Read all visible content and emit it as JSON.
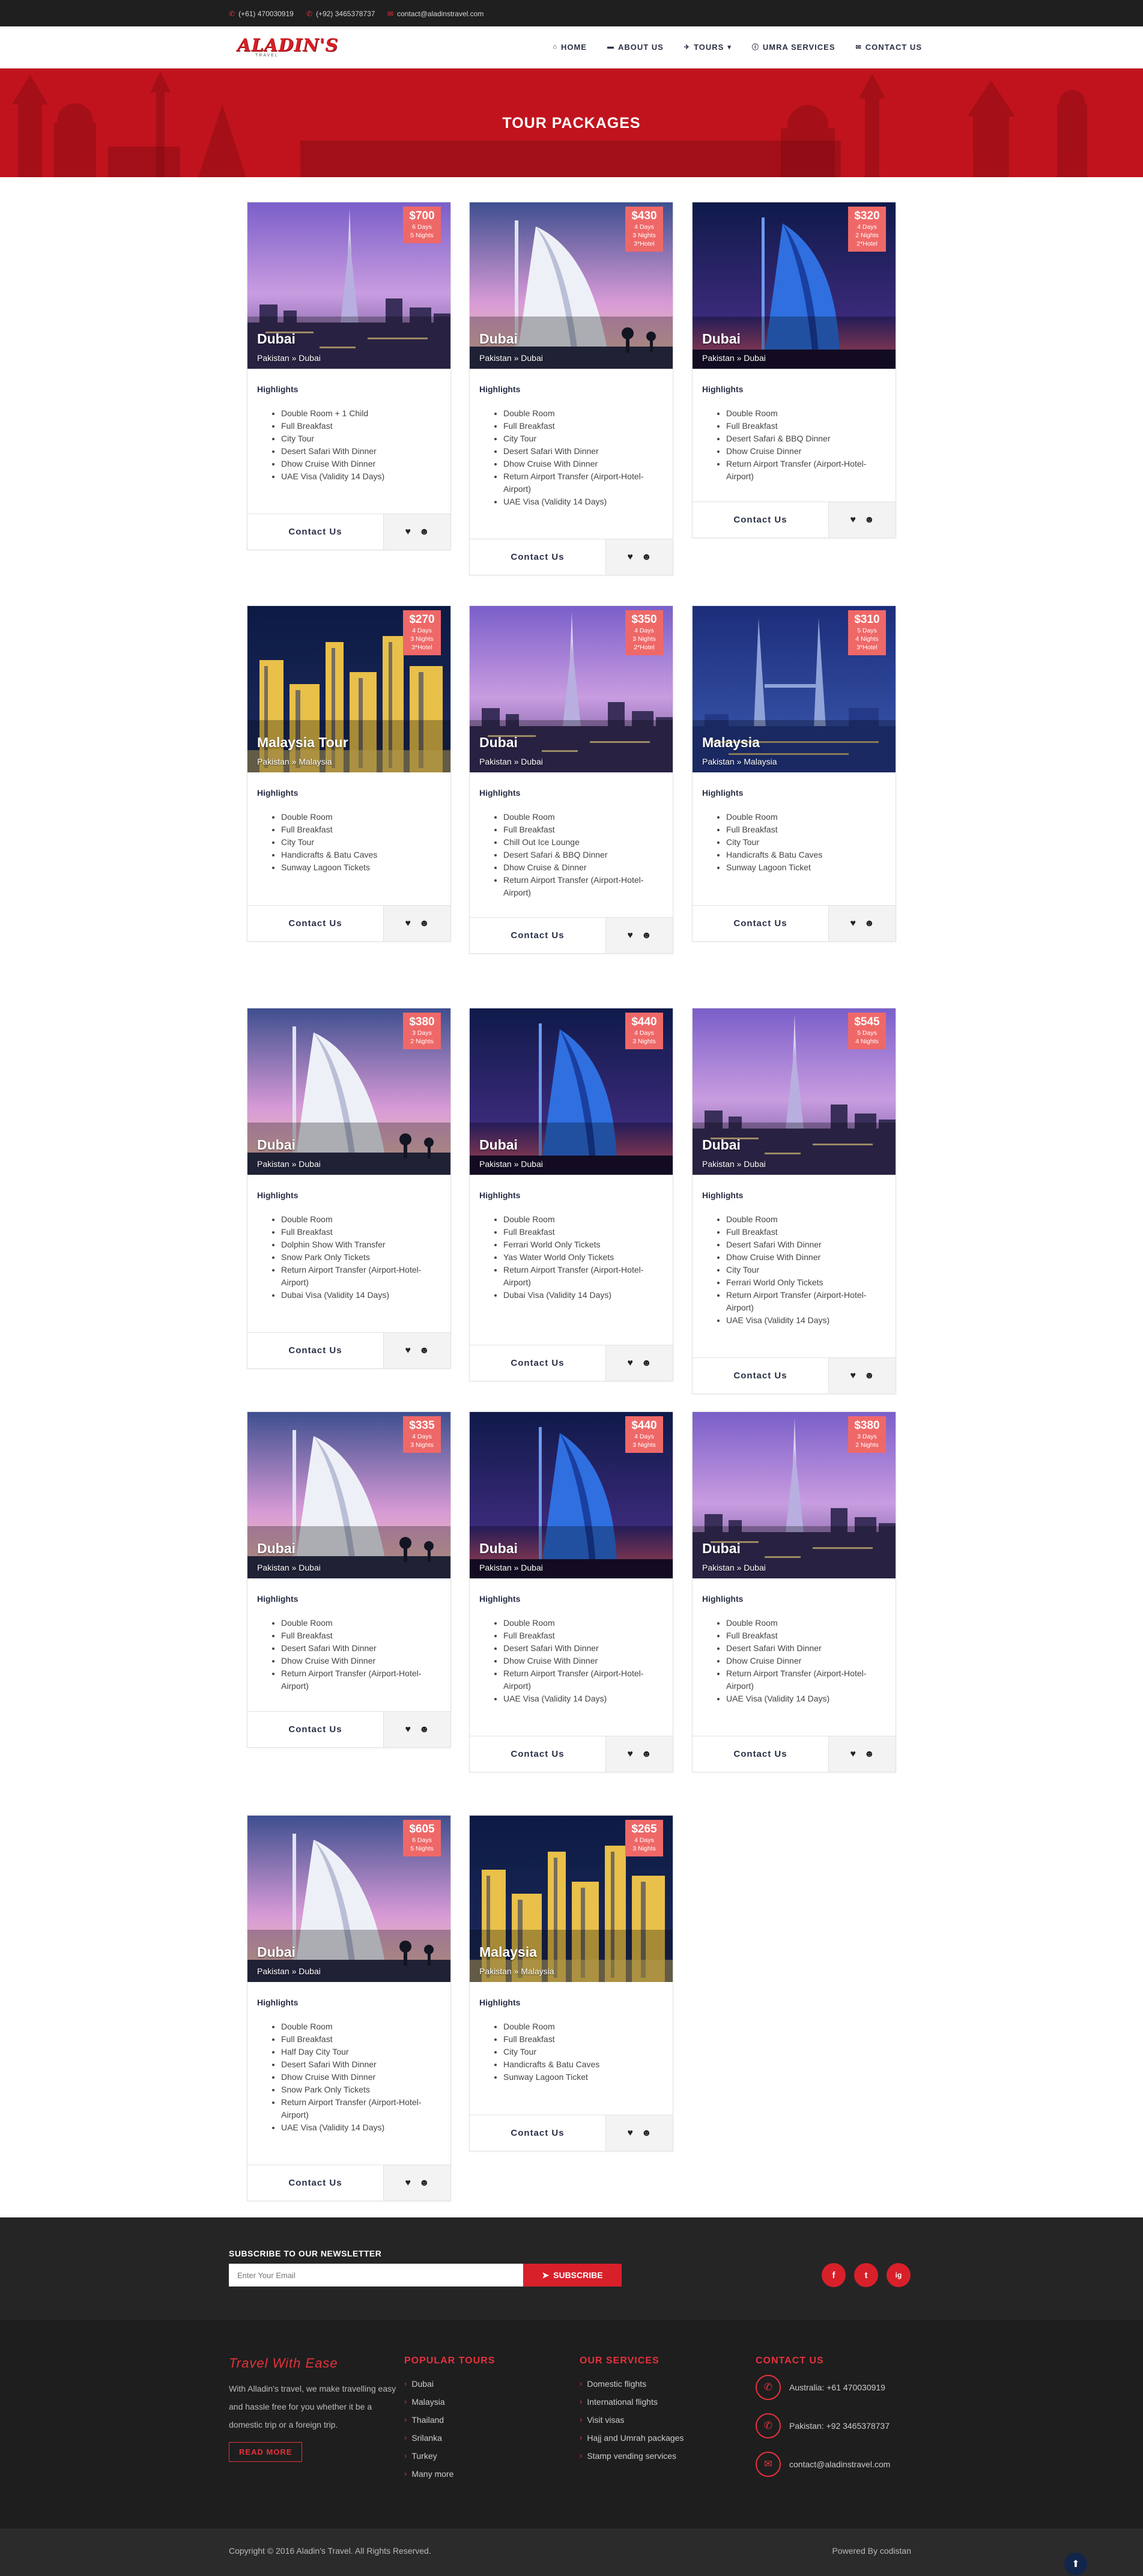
{
  "topbar": {
    "phone1": "(+61) 470030919",
    "phone2": "(+92) 3465378737",
    "email": "contact@aladinstravel.com"
  },
  "brand": {
    "logo_text": "ALADIN'S",
    "logo_sub": "TRAVEL",
    "accent": "#d8202a"
  },
  "menu": {
    "home": "HOME",
    "about": "ABOUT US",
    "tours": "TOURS",
    "umra": "UMRA SERVICES",
    "contact": "CONTACT US"
  },
  "hero": {
    "title": "TOUR PACKAGES"
  },
  "common": {
    "highlights": "Highlights",
    "contact_btn": "Contact Us"
  },
  "cards": [
    {
      "price": "$700",
      "dur": [
        "6 Days",
        "5 Nights"
      ],
      "title": "Dubai",
      "route": "Pakistan » Dubai",
      "scene": "burj_khalifa",
      "items": [
        "Double Room + 1 Child",
        "Full Breakfast",
        "City Tour",
        "Desert Safari With Dinner",
        "Dhow Cruise With Dinner",
        "UAE Visa (Validity 14 Days)"
      ]
    },
    {
      "price": "$430",
      "dur": [
        "4 Days",
        "3 Nights",
        "3*Hotel"
      ],
      "title": "Dubai",
      "route": "Pakistan » Dubai",
      "scene": "burj_arab_day",
      "items": [
        "Double Room",
        "Full Breakfast",
        "City Tour",
        "Desert Safari With Dinner",
        "Dhow Cruise With Dinner",
        "Return Airport Transfer (Airport-Hotel-Airport)",
        "UAE Visa (Validity 14 Days)"
      ]
    },
    {
      "price": "$320",
      "dur": [
        "4 Days",
        "2 Nights",
        "2*Hotel"
      ],
      "title": "Dubai",
      "route": "Pakistan » Dubai",
      "scene": "burj_arab_night",
      "items": [
        "Double Room",
        "Full Breakfast",
        "Desert Safari & BBQ Dinner",
        "Dhow Cruise Dinner",
        "Return Airport Transfer (Airport-Hotel-Airport)"
      ]
    },
    {
      "price": "$270",
      "dur": [
        "4 Days",
        "3 Nights",
        "3*Hotel"
      ],
      "title": "Malaysia Tour",
      "route": "Pakistan » Malaysia",
      "scene": "kl_night",
      "items": [
        "Double Room",
        "Full Breakfast",
        "City Tour",
        "Handicrafts & Batu Caves",
        "Sunway Lagoon Tickets"
      ]
    },
    {
      "price": "$350",
      "dur": [
        "4 Days",
        "3 Nights",
        "2*Hotel"
      ],
      "title": "Dubai",
      "route": "Pakistan » Dubai",
      "scene": "burj_khalifa",
      "items": [
        "Double Room",
        "Full Breakfast",
        "Chill Out Ice Lounge",
        "Desert Safari & BBQ Dinner",
        "Dhow Cruise & Dinner",
        "Return Airport Transfer (Airport-Hotel-Airport)"
      ]
    },
    {
      "price": "$310",
      "dur": [
        "5 Days",
        "4 Nights",
        "3*Hotel"
      ],
      "title": "Malaysia",
      "route": "Pakistan » Malaysia",
      "scene": "petronas",
      "items": [
        "Double Room",
        "Full Breakfast",
        "City Tour",
        "Handicrafts & Batu Caves",
        "Sunway Lagoon Ticket"
      ]
    },
    {
      "price": "$380",
      "dur": [
        "3 Days",
        "2 Nights"
      ],
      "title": "Dubai",
      "route": "Pakistan » Dubai",
      "scene": "burj_arab_day",
      "items": [
        "Double Room",
        "Full Breakfast",
        "Dolphin Show With Transfer",
        "Snow Park Only Tickets",
        "Return Airport Transfer (Airport-Hotel-Airport)",
        "Dubai Visa (Validity 14 Days)"
      ]
    },
    {
      "price": "$440",
      "dur": [
        "4 Days",
        "3 Nights"
      ],
      "title": "Dubai",
      "route": "Pakistan » Dubai",
      "scene": "burj_arab_night",
      "items": [
        "Double Room",
        "Full Breakfast",
        "Ferrari World Only Tickets",
        "Yas Water World Only Tickets",
        "Return Airport Transfer (Airport-Hotel-Airport)",
        "Dubai Visa (Validity 14 Days)"
      ]
    },
    {
      "price": "$545",
      "dur": [
        "5 Days",
        "4 Nights"
      ],
      "title": "Dubai",
      "route": "Pakistan » Dubai",
      "scene": "burj_khalifa",
      "items": [
        "Double Room",
        "Full Breakfast",
        "Desert Safari With Dinner",
        "Dhow Cruise With Dinner",
        "City Tour",
        "Ferrari World Only Tickets",
        "Return Airport Transfer (Airport-Hotel-Airport)",
        "UAE Visa (Validity 14 Days)"
      ]
    },
    {
      "price": "$335",
      "dur": [
        "4 Days",
        "3 Nights"
      ],
      "title": "Dubai",
      "route": "Pakistan » Dubai",
      "scene": "burj_arab_day",
      "items": [
        "Double Room",
        "Full Breakfast",
        "Desert Safari With Dinner",
        "Dhow Cruise With Dinner",
        "Return Airport Transfer (Airport-Hotel-Airport)"
      ]
    },
    {
      "price": "$440",
      "dur": [
        "4 Days",
        "3 Nights"
      ],
      "title": "Dubai",
      "route": "Pakistan » Dubai",
      "scene": "burj_arab_night",
      "items": [
        "Double Room",
        "Full Breakfast",
        "Desert Safari With Dinner",
        "Dhow Cruise With Dinner",
        "Return Airport Transfer (Airport-Hotel-Airport)",
        "UAE Visa (Validity 14 Days)"
      ]
    },
    {
      "price": "$380",
      "dur": [
        "3 Days",
        "2 Nights"
      ],
      "title": "Dubai",
      "route": "Pakistan » Dubai",
      "scene": "burj_khalifa",
      "items": [
        "Double Room",
        "Full Breakfast",
        "Desert Safari With Dinner",
        "Dhow Cruise Dinner",
        "Return Airport Transfer (Airport-Hotel-Airport)",
        "UAE Visa (Validity 14 Days)"
      ]
    },
    {
      "price": "$605",
      "dur": [
        "6 Days",
        "5 Nights"
      ],
      "title": "Dubai",
      "route": "Pakistan » Dubai",
      "scene": "burj_arab_day",
      "items": [
        "Double Room",
        "Full Breakfast",
        "Half Day City Tour",
        "Desert Safari With Dinner",
        "Dhow Cruise With Dinner",
        "Snow Park Only Tickets",
        "Return Airport Transfer (Airport-Hotel-Airport)",
        "UAE Visa (Validity 14 Days)"
      ]
    },
    {
      "price": "$265",
      "dur": [
        "4 Days",
        "3 Nights"
      ],
      "title": "Malaysia",
      "route": "Pakistan » Malaysia",
      "scene": "kl_night",
      "items": [
        "Double Room",
        "Full Breakfast",
        "City Tour",
        "Handicrafts & Batu Caves",
        "Sunway Lagoon Ticket"
      ]
    }
  ],
  "newsletter": {
    "title": "SUBSCRIBE TO OUR NEWSLETTER",
    "placeholder": "Enter Your Email",
    "button": "SUBSCRIBE"
  },
  "social": [
    "f",
    "t",
    "ig"
  ],
  "footer": {
    "about_title": "Travel With Ease",
    "about_text": "With Alladin's travel, we make travelling easy and hassle free for you whether it be a domestic trip or a foreign trip.",
    "read_more": "READ MORE",
    "tours_title": "POPULAR TOURS",
    "tours": [
      "Dubai",
      "Malaysia",
      "Thailand",
      "Srilanka",
      "Turkey",
      "Many more"
    ],
    "services_title": "OUR SERVICES",
    "services": [
      "Domestic flights",
      "International flights",
      "Visit visas",
      "Hajj and Umrah packages",
      "Stamp vending services"
    ],
    "contact_title": "CONTACT US",
    "contacts": [
      "Australia: +61 470030919",
      "Pakistan: +92 3465378737",
      "contact@aladinstravel.com"
    ]
  },
  "copyright": {
    "left": "Copyright © 2016 Aladin's Travel. All Rights Reserved.",
    "right": "Powered By codistan"
  }
}
